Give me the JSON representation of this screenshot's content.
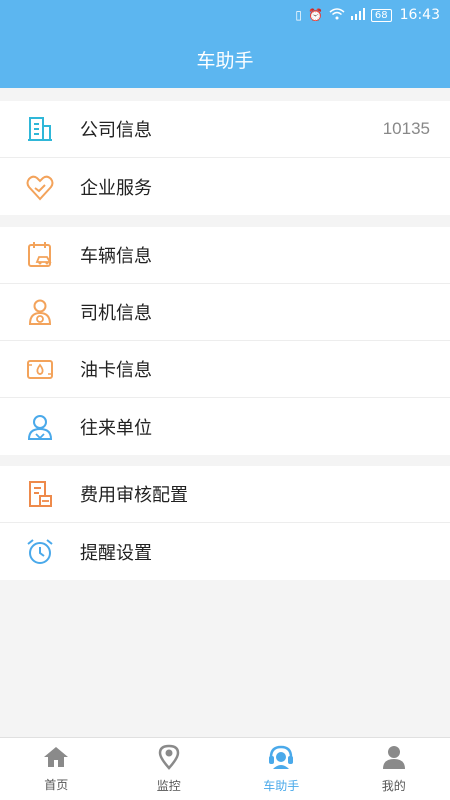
{
  "status_bar": {
    "time": "16:43",
    "battery": "68"
  },
  "header": {
    "title": "车助手"
  },
  "groups": [
    {
      "items": [
        {
          "label": "公司信息",
          "value": "10135",
          "icon": "building-icon"
        },
        {
          "label": "企业服务",
          "icon": "handshake-heart-icon"
        }
      ]
    },
    {
      "items": [
        {
          "label": "车辆信息",
          "icon": "car-calendar-icon"
        },
        {
          "label": "司机信息",
          "icon": "driver-icon"
        },
        {
          "label": "油卡信息",
          "icon": "fuel-card-icon"
        },
        {
          "label": "往来单位",
          "icon": "contact-person-icon"
        }
      ]
    },
    {
      "items": [
        {
          "label": "费用审核配置",
          "icon": "audit-document-icon"
        },
        {
          "label": "提醒设置",
          "icon": "alarm-clock-icon"
        }
      ]
    }
  ],
  "tabbar": {
    "tabs": [
      {
        "label": "首页",
        "icon": "home-icon"
      },
      {
        "label": "监控",
        "icon": "location-pin-icon"
      },
      {
        "label": "车助手",
        "icon": "headset-assistant-icon",
        "active": true
      },
      {
        "label": "我的",
        "icon": "user-icon"
      }
    ]
  },
  "colors": {
    "primary": "#5cb6f0",
    "icon_orange": "#f3a35b",
    "icon_blue": "#4aa9ea"
  }
}
